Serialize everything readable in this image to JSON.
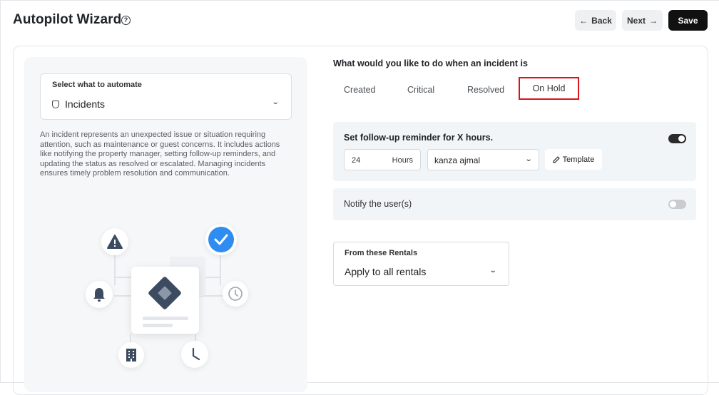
{
  "header": {
    "title": "Autopilot Wizard",
    "help_glyph": "?",
    "back_label": "Back",
    "next_label": "Next",
    "save_label": "Save"
  },
  "automate": {
    "label": "Select what to automate",
    "value": "Incidents",
    "icon": "shield-icon",
    "description": "An incident represents an unexpected issue or situation requiring attention, such as maintenance or guest concerns. It includes actions like notifying the property manager, setting follow-up reminders, and updating the status as resolved or escalated. Managing incidents ensures timely problem resolution and communication."
  },
  "incident": {
    "question": "What would you like to do when an incident is",
    "tabs": [
      {
        "label": "Created"
      },
      {
        "label": "Critical"
      },
      {
        "label": "Resolved"
      },
      {
        "label": "On Hold",
        "selected": true
      }
    ]
  },
  "followup": {
    "title": "Set follow-up reminder for X hours.",
    "enabled": true,
    "hours_value": "24",
    "hours_unit": "Hours",
    "user": "kanza ajmal",
    "template_label": "Template"
  },
  "notify": {
    "title": "Notify the user(s)",
    "enabled": false
  },
  "rentals": {
    "label": "From these Rentals",
    "value": "Apply to all rentals"
  },
  "colors": {
    "accent": "#d9141b",
    "check": "#2f8cf0",
    "dark": "#111111"
  }
}
